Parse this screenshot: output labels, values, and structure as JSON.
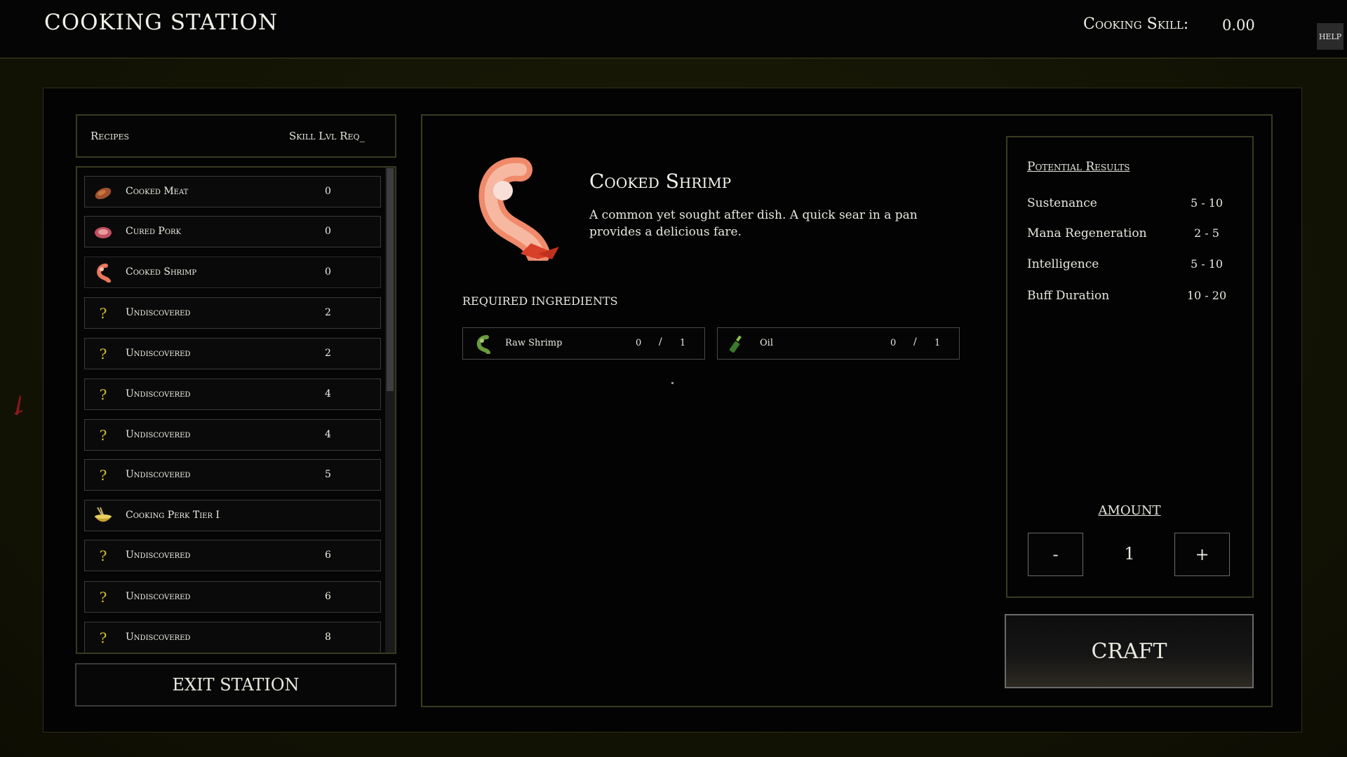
{
  "header": {
    "title": "COOKING STATION",
    "skill_label": "Cooking Skill:",
    "skill_value": "0.00",
    "help_label": "HELP"
  },
  "recipes": {
    "col_recipes": "Recipes",
    "col_skill": "Skill Lvl Req_",
    "items": [
      {
        "name": "Cooked Meat",
        "level": "0",
        "icon": "cooked-meat-icon"
      },
      {
        "name": "Cured Pork",
        "level": "0",
        "icon": "cured-pork-icon"
      },
      {
        "name": "Cooked Shrimp",
        "level": "0",
        "icon": "cooked-shrimp-icon"
      },
      {
        "name": "Undiscovered",
        "level": "2",
        "icon": "question-mark-icon"
      },
      {
        "name": "Undiscovered",
        "level": "2",
        "icon": "question-mark-icon"
      },
      {
        "name": "Undiscovered",
        "level": "4",
        "icon": "question-mark-icon"
      },
      {
        "name": "Undiscovered",
        "level": "4",
        "icon": "question-mark-icon"
      },
      {
        "name": "Undiscovered",
        "level": "5",
        "icon": "question-mark-icon"
      },
      {
        "name": "Cooking Perk Tier I",
        "level": "",
        "icon": "cooking-bowl-icon"
      },
      {
        "name": "Undiscovered",
        "level": "6",
        "icon": "question-mark-icon"
      },
      {
        "name": "Undiscovered",
        "level": "6",
        "icon": "question-mark-icon"
      },
      {
        "name": "Undiscovered",
        "level": "8",
        "icon": "question-mark-icon"
      }
    ],
    "question_glyph": "?"
  },
  "exit_label": "EXIT STATION",
  "detail": {
    "name": "Cooked Shrimp",
    "description": "A common yet sought after dish.  A quick sear in a pan provides a delicious fare.",
    "required_title": "REQUIRED INGREDIENTS",
    "ingredients": [
      {
        "name": "Raw Shrimp",
        "have": "0",
        "sep": "/",
        "need": "1",
        "icon": "raw-shrimp-icon"
      },
      {
        "name": "Oil",
        "have": "0",
        "sep": "/",
        "need": "1",
        "icon": "oil-bottle-icon"
      }
    ]
  },
  "results": {
    "title": "Potential Results",
    "stats": [
      {
        "name": "Sustenance",
        "value": "5 - 10"
      },
      {
        "name": "Mana Regeneration",
        "value": "2 - 5"
      },
      {
        "name": "Intelligence",
        "value": "5 - 10"
      },
      {
        "name": "Buff Duration",
        "value": "10 - 20"
      }
    ],
    "amount_title": "AMOUNT",
    "minus_label": "-",
    "amount_value": "1",
    "plus_label": "+"
  },
  "craft_label": "CRAFT"
}
